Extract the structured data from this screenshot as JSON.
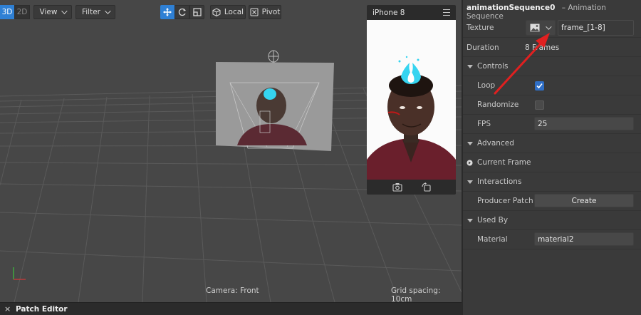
{
  "toolbar": {
    "mode_3d": "3D",
    "mode_2d": "2D",
    "view_label": "View",
    "filter_label": "Filter",
    "local_label": "Local",
    "pivot_label": "Pivot"
  },
  "viewport": {
    "camera_label": "Camera: Front",
    "grid_spacing_label": "Grid spacing: 10cm"
  },
  "phone_preview": {
    "device_name": "iPhone 8"
  },
  "patch_editor": {
    "close": "×",
    "title": "Patch Editor"
  },
  "inspector": {
    "object_name": "animationSequence0",
    "object_type": "– Animation Sequence",
    "texture_label": "Texture",
    "texture_value": "frame_[1-8]",
    "duration_label": "Duration",
    "duration_value": "8 Frames",
    "controls_label": "Controls",
    "loop_label": "Loop",
    "loop_checked": true,
    "randomize_label": "Randomize",
    "randomize_checked": false,
    "fps_label": "FPS",
    "fps_value": "25",
    "advanced_label": "Advanced",
    "current_frame_label": "Current Frame",
    "interactions_label": "Interactions",
    "producer_patch_label": "Producer Patch",
    "create_label": "Create",
    "used_by_label": "Used By",
    "material_label": "Material",
    "material_value": "material2"
  },
  "colors": {
    "accent_blue": "#2f80d4",
    "annotation_arrow": "#e02020",
    "flame": "#35d4f0"
  }
}
